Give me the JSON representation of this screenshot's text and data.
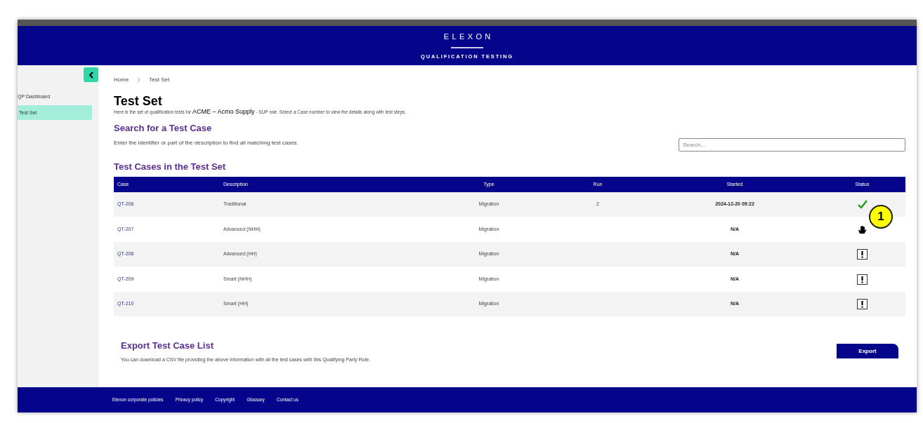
{
  "header": {
    "brand": "ELEXON",
    "subtitle": "QUALIFICATION TESTING"
  },
  "sidebar": {
    "items": [
      {
        "label": "QP Dashboard",
        "selected": false
      },
      {
        "label": "Test Set",
        "selected": true
      }
    ]
  },
  "breadcrumb": [
    "Home",
    "Test Set"
  ],
  "title": "Test Set",
  "intro": {
    "before": "Here is the set of qualification tests for ",
    "party": "ACME – Acmo Supply",
    "after": " - SUP role. Select a Case number to view the details along with test steps."
  },
  "search_section": {
    "heading": "Search for a Test Case",
    "text": "Enter the identifier or part of the description to find all matching test cases.",
    "placeholder": "Search..."
  },
  "table": {
    "heading": "Test Cases in the Test Set",
    "columns": [
      "Case",
      "Description",
      "Type",
      "Run",
      "Started",
      "Status"
    ],
    "rows": [
      {
        "case": "QT-206",
        "description": "Traditional",
        "type": "Migration",
        "run": "2",
        "started": "2024-12-20 09:22",
        "kind": "passed"
      },
      {
        "case": "QT-207",
        "description": "Advanced (NHH)",
        "type": "Migration",
        "started": "N/A",
        "kind": "on_hold"
      },
      {
        "case": "QT-208",
        "description": "Advanced (HH)",
        "type": "Migration",
        "started": "N/A",
        "kind": "warning"
      },
      {
        "case": "QT-209",
        "description": "Smart (NHH)",
        "type": "Migration",
        "started": "N/A",
        "kind": "warning"
      },
      {
        "case": "QT-210",
        "description": "Smart (HH)",
        "type": "Migration",
        "started": "N/A",
        "kind": "warning"
      }
    ]
  },
  "callout": {
    "label": "1"
  },
  "export": {
    "heading": "Export Test Case List",
    "text": "You can download a CSV file providing the above information with all the test cases with this Qualifying Party Role.",
    "button": "Export"
  },
  "footer": {
    "links": [
      "Elexon corporate policies",
      "Privacy policy",
      "Copyright",
      "Glossary",
      "Contact us"
    ]
  }
}
